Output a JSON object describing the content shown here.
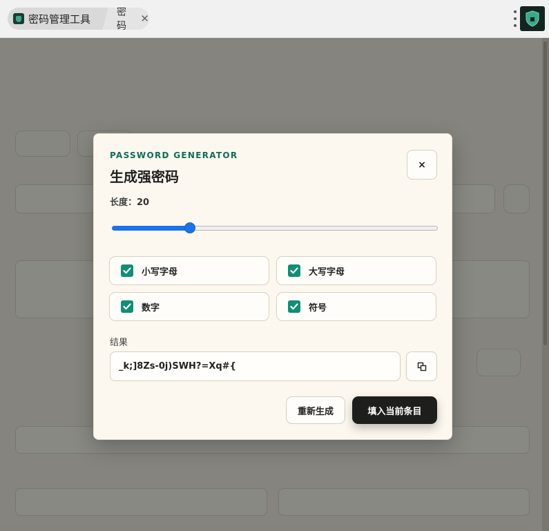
{
  "browser": {
    "app_tab_label": "密码管理工具",
    "current_tab_label": "密码",
    "close_glyph": "✕",
    "accent": "#132521"
  },
  "modal": {
    "eyebrow": "PASSWORD GENERATOR",
    "title": "生成强密码",
    "close_glyph": "×",
    "length_label": "长度：",
    "length_value": "20",
    "length_fraction": 0.24,
    "options": [
      {
        "label": "小写字母",
        "checked": true
      },
      {
        "label": "大写字母",
        "checked": true
      },
      {
        "label": "数字",
        "checked": true
      },
      {
        "label": "符号",
        "checked": true
      }
    ],
    "result_label": "结果",
    "result_value": "_k;]8Zs-0j)SWH?=Xq#{",
    "regenerate_label": "重新生成",
    "fill_label": "填入当前条目",
    "colors": {
      "accent": "#0f6e57",
      "checkbox": "#0f8f74",
      "slider": "#1a73e8",
      "primary_button": "#1e1f1c"
    }
  }
}
